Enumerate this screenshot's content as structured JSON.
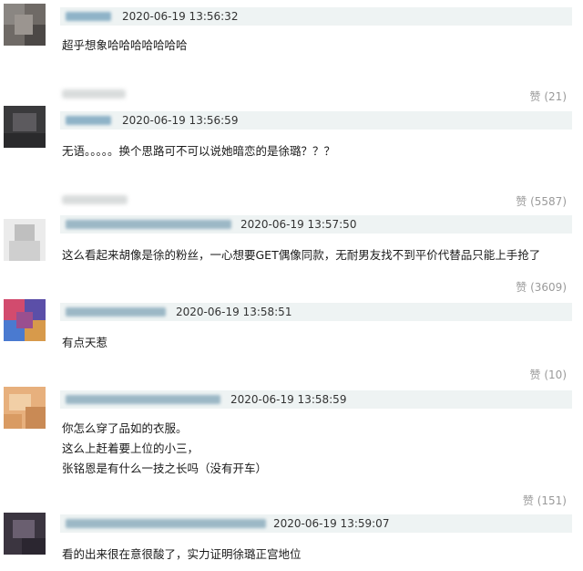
{
  "comments": [
    {
      "timestamp": "2020-06-19 13:56:32",
      "text": [
        "超乎想象哈哈哈哈哈哈哈"
      ],
      "likes": "赞 (21)"
    },
    {
      "timestamp": "2020-06-19 13:56:59",
      "text": [
        "无语。。。。。换个思路可不可以说她暗恋的是徐璐？？？"
      ],
      "likes": "赞 (5587)"
    },
    {
      "timestamp": "2020-06-19 13:57:50",
      "text": [
        "这么看起来胡像是徐的粉丝，一心想要GET偶像同款，无耐男友找不到平价代替品只能上手抢了"
      ],
      "likes": "赞 (3609)"
    },
    {
      "timestamp": "2020-06-19 13:58:51",
      "text": [
        "有点天惹"
      ],
      "likes": "赞 (10)"
    },
    {
      "timestamp": "2020-06-19 13:58:59",
      "text": [
        "你怎么穿了品如的衣服。",
        "这么上赶着要上位的小三，",
        "张铭恩是有什么一技之长吗（没有开车）"
      ],
      "likes": "赞 (151)"
    },
    {
      "timestamp": "2020-06-19 13:59:07",
      "text": [
        "看的出来很在意很酸了，实力证明徐璐正宫地位"
      ]
    }
  ]
}
